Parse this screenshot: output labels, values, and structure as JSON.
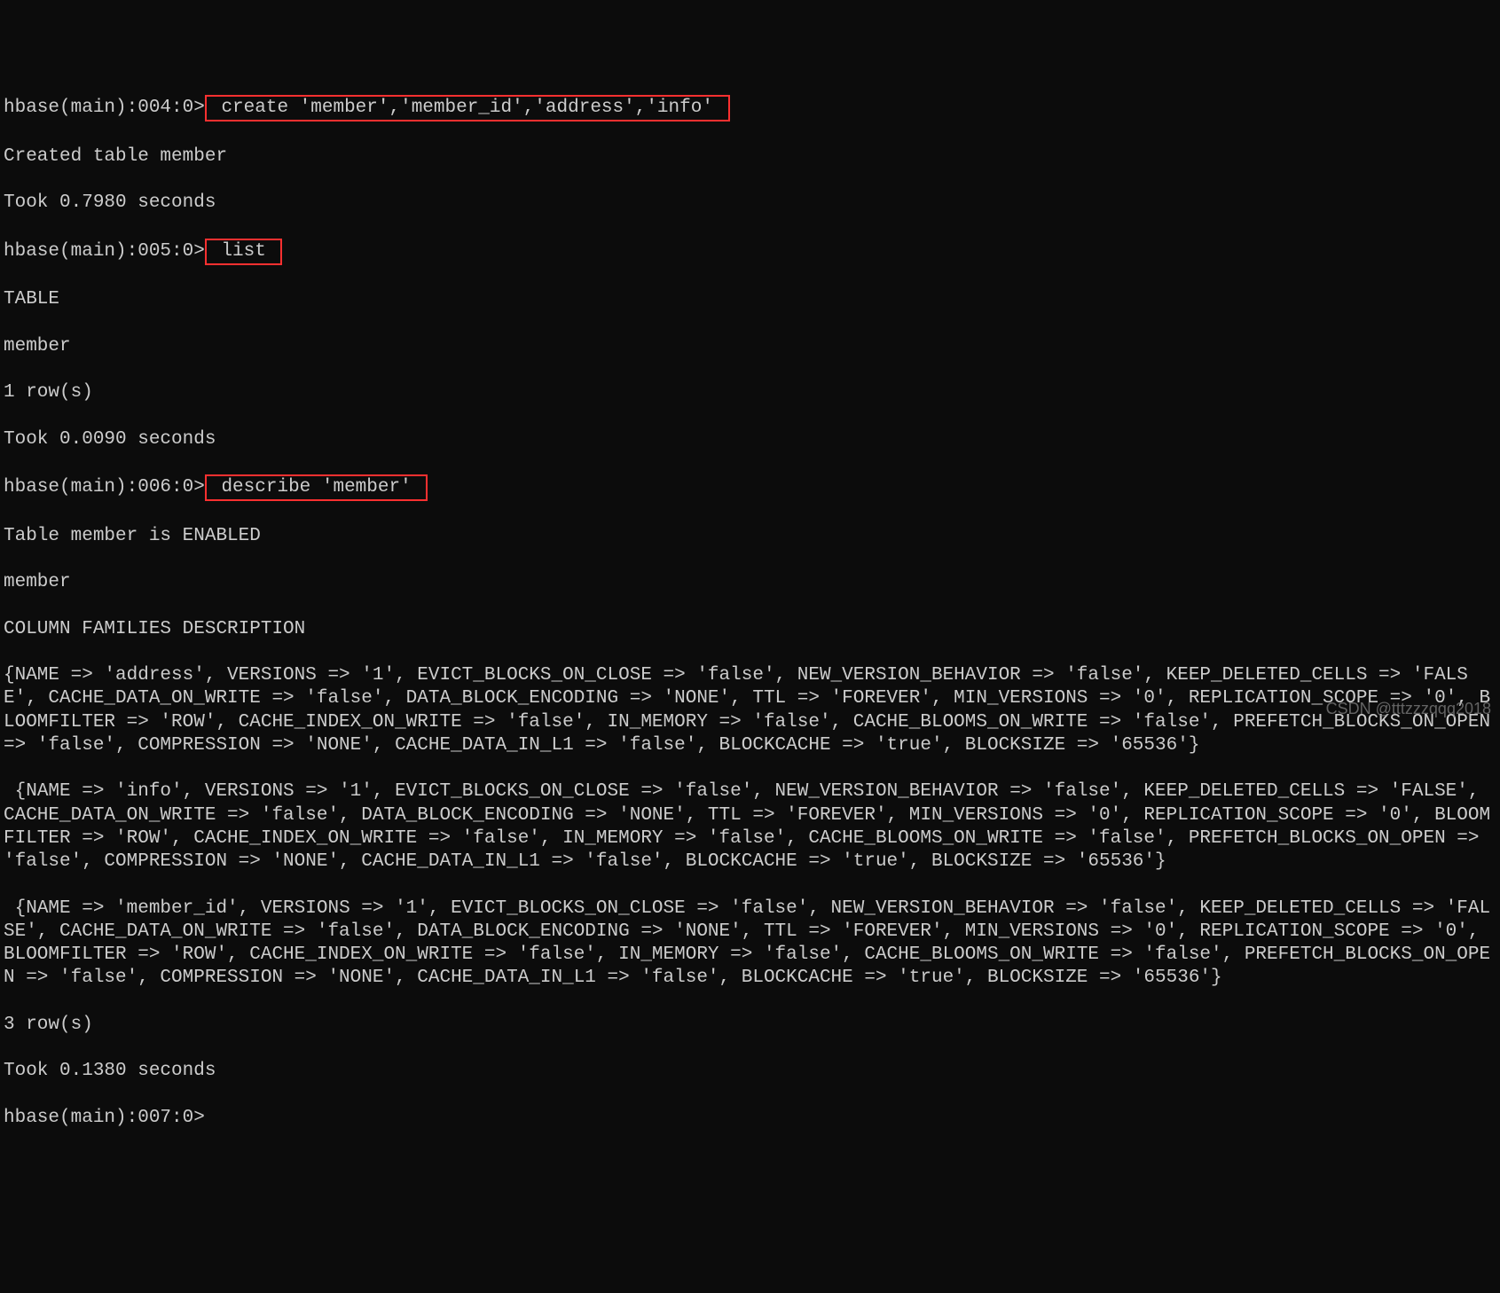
{
  "lines": {
    "p4": "hbase(main):004:0>",
    "cmd_create": " create 'member','member_id','address','info' ",
    "created": "Created table member",
    "took1": "Took 0.7980 seconds",
    "p5": "hbase(main):005:0>",
    "cmd_list": " list ",
    "table_header": "TABLE",
    "table_name": "member",
    "rows1": "1 row(s)",
    "took2": "Took 0.0090 seconds",
    "p6": "hbase(main):006:0>",
    "cmd_describe": " describe 'member' ",
    "enabled": "Table member is ENABLED",
    "member2": "member",
    "colfam": "COLUMN FAMILIES DESCRIPTION",
    "cf1": "{NAME => 'address', VERSIONS => '1', EVICT_BLOCKS_ON_CLOSE => 'false', NEW_VERSION_BEHAVIOR => 'false', KEEP_DELETED_CELLS => 'FALSE', CACHE_DATA_ON_WRITE => 'false', DATA_BLOCK_ENCODING => 'NONE', TTL => 'FOREVER', MIN_VERSIONS => '0', REPLICATION_SCOPE => '0', BLOOMFILTER => 'ROW', CACHE_INDEX_ON_WRITE => 'false', IN_MEMORY => 'false', CACHE_BLOOMS_ON_WRITE => 'false', PREFETCH_BLOCKS_ON_OPEN => 'false', COMPRESSION => 'NONE', CACHE_DATA_IN_L1 => 'false', BLOCKCACHE => 'true', BLOCKSIZE => '65536'}",
    "cf2": " {NAME => 'info', VERSIONS => '1', EVICT_BLOCKS_ON_CLOSE => 'false', NEW_VERSION_BEHAVIOR => 'false', KEEP_DELETED_CELLS => 'FALSE', CACHE_DATA_ON_WRITE => 'false', DATA_BLOCK_ENCODING => 'NONE', TTL => 'FOREVER', MIN_VERSIONS => '0', REPLICATION_SCOPE => '0', BLOOMFILTER => 'ROW', CACHE_INDEX_ON_WRITE => 'false', IN_MEMORY => 'false', CACHE_BLOOMS_ON_WRITE => 'false', PREFETCH_BLOCKS_ON_OPEN => 'false', COMPRESSION => 'NONE', CACHE_DATA_IN_L1 => 'false', BLOCKCACHE => 'true', BLOCKSIZE => '65536'}",
    "cf3": " {NAME => 'member_id', VERSIONS => '1', EVICT_BLOCKS_ON_CLOSE => 'false', NEW_VERSION_BEHAVIOR => 'false', KEEP_DELETED_CELLS => 'FALSE', CACHE_DATA_ON_WRITE => 'false', DATA_BLOCK_ENCODING => 'NONE', TTL => 'FOREVER', MIN_VERSIONS => '0', REPLICATION_SCOPE => '0', BLOOMFILTER => 'ROW', CACHE_INDEX_ON_WRITE => 'false', IN_MEMORY => 'false', CACHE_BLOOMS_ON_WRITE => 'false', PREFETCH_BLOCKS_ON_OPEN => 'false', COMPRESSION => 'NONE', CACHE_DATA_IN_L1 => 'false', BLOCKCACHE => 'true', BLOCKSIZE => '65536'}",
    "rows3": "3 row(s)",
    "took3": "Took 0.1380 seconds",
    "p7": "hbase(main):007:0>"
  },
  "watermark": "CSDN @tttzzzqqq2018"
}
